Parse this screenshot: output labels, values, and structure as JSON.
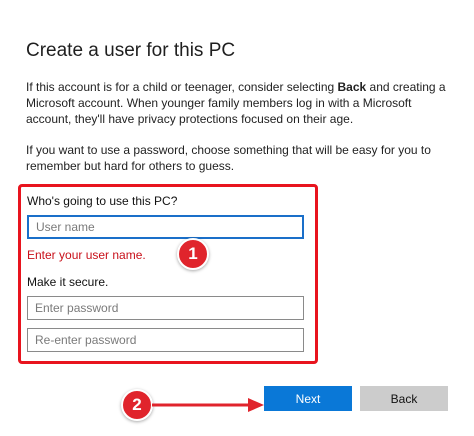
{
  "header": {
    "title": "Create a user for this PC"
  },
  "intro": {
    "child_text_before": "If this account is for a child or teenager, consider selecting ",
    "child_text_bold": "Back",
    "child_text_after": " and creating a Microsoft account. When younger family members log in with a Microsoft account, they'll have privacy protections focused on their age.",
    "password_text": "If you want to use a password, choose something that will be easy for you to remember but hard for others to guess."
  },
  "form": {
    "user_question": "Who's going to use this PC?",
    "username_placeholder": "User name",
    "error_message": "Enter your user name.",
    "secure_label": "Make it secure.",
    "password_placeholder": "Enter password",
    "reenter_placeholder": "Re-enter password"
  },
  "annotations": {
    "marker_1": "1",
    "marker_2": "2",
    "highlight_color": "#e8141e"
  },
  "buttons": {
    "next_label": "Next",
    "back_label": "Back"
  },
  "colors": {
    "accent": "#0a78d7",
    "error": "#c8101a",
    "focus_border": "#1a6fc9"
  }
}
